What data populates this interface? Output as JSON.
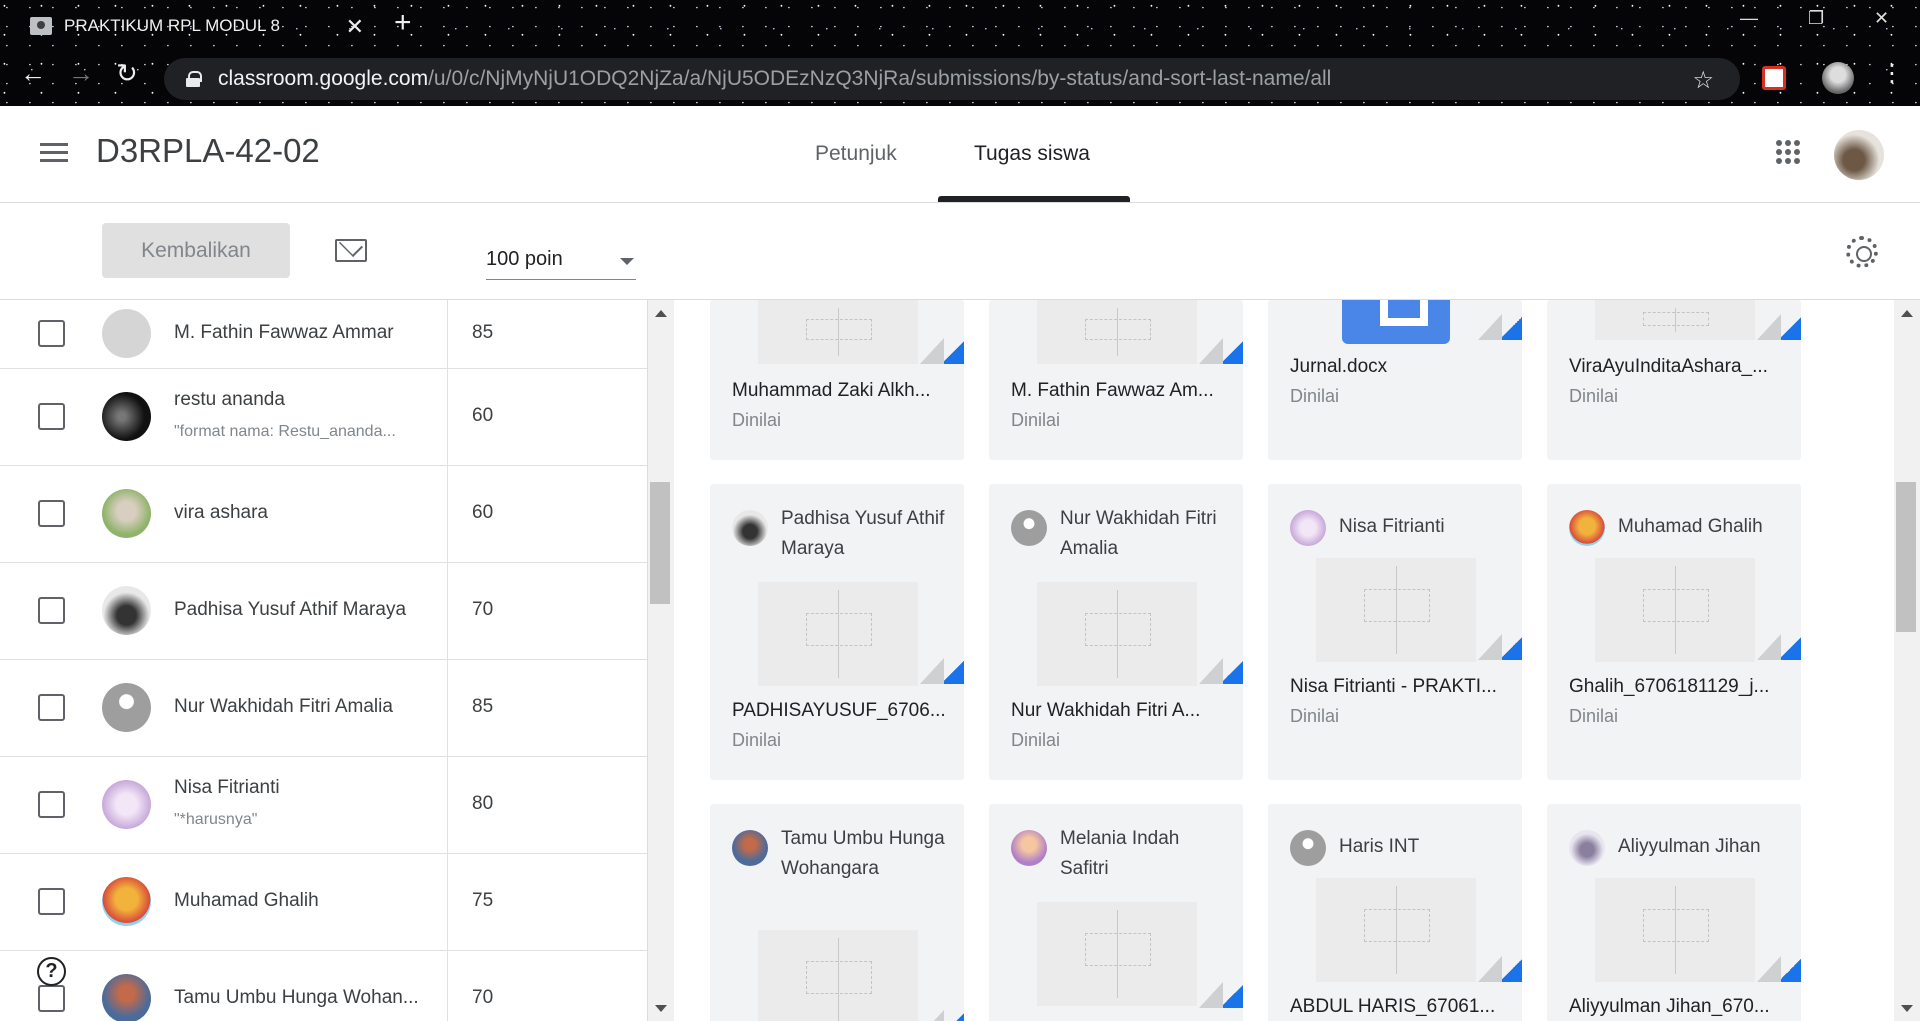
{
  "browser": {
    "tab_title": "PRAKTIKUM RPL MODUL 8",
    "url_host": "classroom.google.com",
    "url_path": "/u/0/c/NjMyNjU1ODQ2NjZa/a/NjU5ODEzNzQ3NjRa/submissions/by-status/and-sort-last-name/all"
  },
  "header": {
    "class_title": "D3RPLA-42-02",
    "tabs": [
      {
        "label": "Petunjuk",
        "active": false
      },
      {
        "label": "Tugas siswa",
        "active": true
      }
    ]
  },
  "toolbar": {
    "return_label": "Kembalikan",
    "points": "100 poin"
  },
  "students": [
    {
      "name": "M. Fathin Fawwaz Ammar",
      "comment": "",
      "grade": "85"
    },
    {
      "name": "restu ananda",
      "comment": "\"format nama: Restu_ananda...",
      "grade": "60"
    },
    {
      "name": "vira ashara",
      "comment": "",
      "grade": "60"
    },
    {
      "name": "Padhisa Yusuf Athif Maraya",
      "comment": "",
      "grade": "70"
    },
    {
      "name": "Nur Wakhidah Fitri Amalia",
      "comment": "",
      "grade": "85"
    },
    {
      "name": "Nisa Fitrianti",
      "comment": "\"*harusnya\"",
      "grade": "80"
    },
    {
      "name": "Muhamad Ghalih",
      "comment": "",
      "grade": "75"
    },
    {
      "name": "Tamu Umbu Hunga Wohan...",
      "comment": "",
      "grade": "70"
    }
  ],
  "cards": [
    {
      "student": "",
      "file": "Muhammad Zaki Alkh...",
      "status": "Dinilai"
    },
    {
      "student": "",
      "file": "M. Fathin Fawwaz Am...",
      "status": "Dinilai"
    },
    {
      "student": "",
      "file": "Jurnal.docx",
      "status": "Dinilai"
    },
    {
      "student": "",
      "file": "ViraAyuInditaAshara_...",
      "status": "Dinilai"
    },
    {
      "student": "Padhisa Yusuf Athif Maraya",
      "file": "PADHISAYUSUF_6706...",
      "status": "Dinilai"
    },
    {
      "student": "Nur Wakhidah Fitri Amalia",
      "file": "Nur Wakhidah Fitri A...",
      "status": "Dinilai"
    },
    {
      "student": "Nisa Fitrianti",
      "file": "Nisa Fitrianti - PRAKTI...",
      "status": "Dinilai"
    },
    {
      "student": "Muhamad Ghalih",
      "file": "Ghalih_6706181129_j...",
      "status": "Dinilai"
    },
    {
      "student": "Tamu Umbu Hunga Wohangara",
      "file": "",
      "status": ""
    },
    {
      "student": "Melania Indah Safitri",
      "file": "",
      "status": ""
    },
    {
      "student": "Haris INT",
      "file": "ABDUL HARIS_67061...",
      "status": ""
    },
    {
      "student": "Aliyyulman Jihan",
      "file": "Aliyyulman Jihan_670...",
      "status": ""
    }
  ],
  "help_label": "?",
  "colors": {
    "accent": "#1a73e8",
    "text": "#3c4043",
    "muted": "#80868b",
    "card_bg": "#f1f3f4"
  }
}
